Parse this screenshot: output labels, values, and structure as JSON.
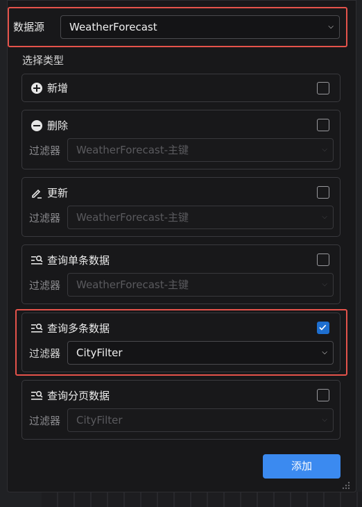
{
  "datasource": {
    "label": "数据源",
    "value": "WeatherForecast"
  },
  "section_title": "选择类型",
  "cards": [
    {
      "title": "新增",
      "icon": "plus-circle-icon",
      "checked": false
    },
    {
      "title": "删除",
      "icon": "minus-circle-icon",
      "checked": false,
      "filter_label": "过滤器",
      "filter_value": "WeatherForecast-主键",
      "filter_disabled": true
    },
    {
      "title": "更新",
      "icon": "edit-pen-icon",
      "checked": false,
      "filter_label": "过滤器",
      "filter_value": "WeatherForecast-主键",
      "filter_disabled": true
    },
    {
      "title": "查询单条数据",
      "icon": "list-search-icon",
      "checked": false,
      "filter_label": "过滤器",
      "filter_value": "WeatherForecast-主键",
      "filter_disabled": true
    },
    {
      "title": "查询多条数据",
      "icon": "list-search-icon",
      "checked": true,
      "filter_label": "过滤器",
      "filter_value": "CityFilter",
      "filter_disabled": false
    },
    {
      "title": "查询分页数据",
      "icon": "list-search-icon",
      "checked": false,
      "filter_label": "过滤器",
      "filter_value": "CityFilter",
      "filter_disabled": true
    }
  ],
  "add_button": "添加",
  "colors": {
    "accent": "#3b8af0",
    "highlight": "#e5534b",
    "checkbox_on": "#1e6fd0"
  }
}
